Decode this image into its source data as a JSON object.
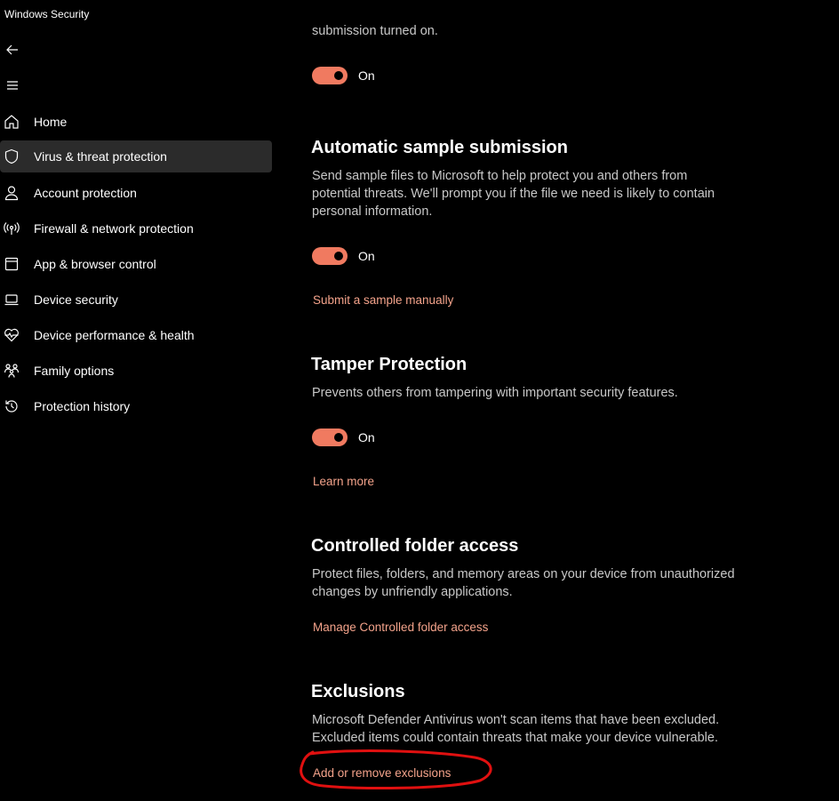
{
  "window": {
    "title": "Windows Security"
  },
  "nav": {
    "back_icon": "back-arrow-icon",
    "menu_icon": "hamburger-menu-icon"
  },
  "sidebar": {
    "items": [
      {
        "label": "Home",
        "icon": "home-icon",
        "selected": false
      },
      {
        "label": "Virus & threat protection",
        "icon": "shield-icon",
        "selected": true
      },
      {
        "label": "Account protection",
        "icon": "person-icon",
        "selected": false
      },
      {
        "label": "Firewall & network protection",
        "icon": "antenna-icon",
        "selected": false
      },
      {
        "label": "App & browser control",
        "icon": "browser-window-icon",
        "selected": false
      },
      {
        "label": "Device security",
        "icon": "laptop-icon",
        "selected": false
      },
      {
        "label": "Device performance & health",
        "icon": "heart-pulse-icon",
        "selected": false
      },
      {
        "label": "Family options",
        "icon": "family-icon",
        "selected": false
      },
      {
        "label": "Protection history",
        "icon": "history-icon",
        "selected": false
      }
    ]
  },
  "main": {
    "partial_text": "submission turned on.",
    "cloud_toggle": {
      "label": "On",
      "state": "on"
    },
    "sample_submission": {
      "title": "Automatic sample submission",
      "description": "Send sample files to Microsoft to help protect you and others from potential threats. We'll prompt you if the file we need is likely to contain personal information.",
      "toggle_label": "On",
      "link": "Submit a sample manually"
    },
    "tamper": {
      "title": "Tamper Protection",
      "description": "Prevents others from tampering with important security features.",
      "toggle_label": "On",
      "link": "Learn more"
    },
    "controlled_folder": {
      "title": "Controlled folder access",
      "description": "Protect files, folders, and memory areas on your device from unauthorized changes by unfriendly applications.",
      "link": "Manage Controlled folder access"
    },
    "exclusions": {
      "title": "Exclusions",
      "description": "Microsoft Defender Antivirus won't scan items that have been excluded. Excluded items could contain threats that make your device vulnerable.",
      "link": "Add or remove exclusions"
    }
  },
  "colors": {
    "background": "#000000",
    "accent_toggle": "#f07a60",
    "link": "#f4a38b",
    "annotation_circle": "#e01010",
    "selected_item": "#2b2b2b"
  }
}
